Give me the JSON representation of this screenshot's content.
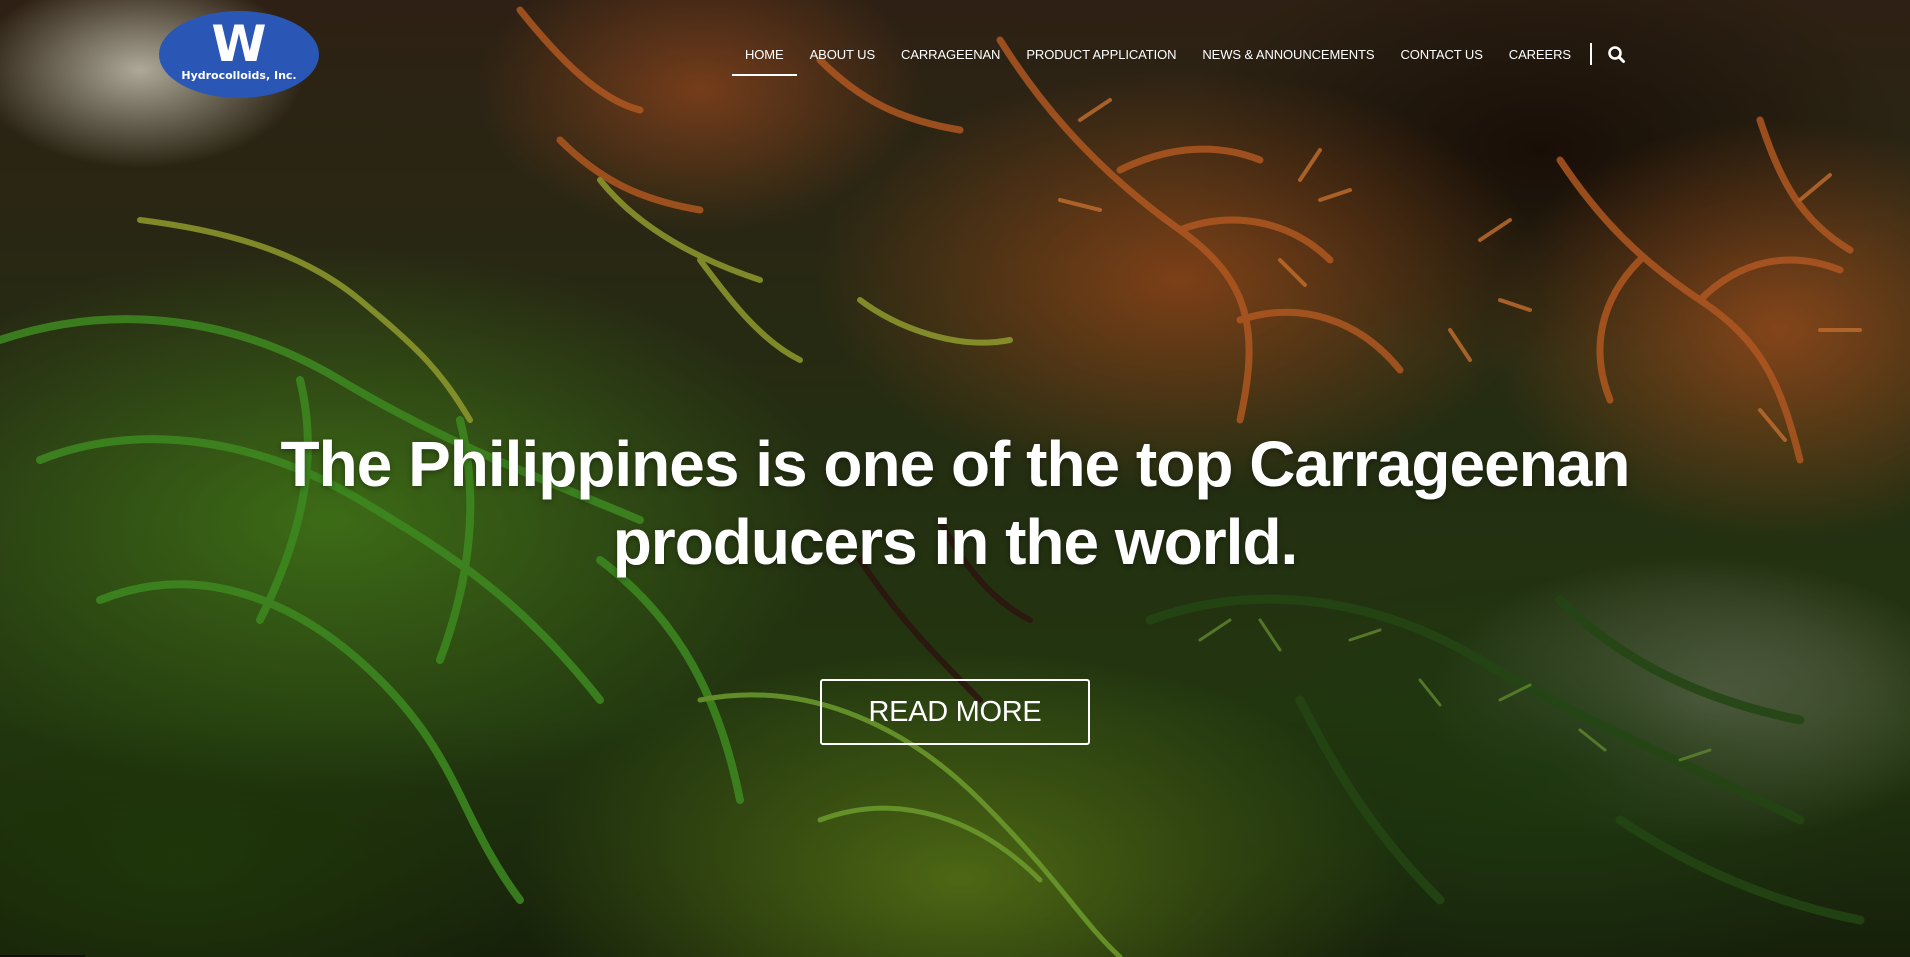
{
  "brand": {
    "logo_letter": "W",
    "logo_name": "Hydrocolloids, Inc.",
    "logo_color": "#2a57b5"
  },
  "nav": {
    "items": [
      {
        "label": "HOME",
        "active": true
      },
      {
        "label": "ABOUT US",
        "active": false
      },
      {
        "label": "CARRAGEENAN",
        "active": false
      },
      {
        "label": "PRODUCT APPLICATION",
        "active": false
      },
      {
        "label": "NEWS & ANNOUNCEMENTS",
        "active": false
      },
      {
        "label": "CONTACT US",
        "active": false
      },
      {
        "label": "CAREERS",
        "active": false
      }
    ],
    "search_icon": "search-icon"
  },
  "hero": {
    "headline_line1": "The Philippines is one of the top Carrageenan",
    "headline_line2": "producers in the world.",
    "cta_label": "READ MORE"
  }
}
